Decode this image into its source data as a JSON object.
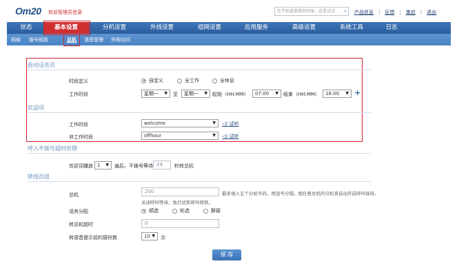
{
  "brand": {
    "logo": "Om20",
    "welcome": "欢迎管理员登录"
  },
  "search": {
    "placeholder": "在不知道菜单的时候，这里试试"
  },
  "top_links": [
    "产品信息",
    "反馈",
    "重启",
    "退出"
  ],
  "main_nav": [
    "状态",
    "基本设置",
    "分机设置",
    "外线设置",
    "组网设置",
    "应用服务",
    "高级设置",
    "系统工具",
    "日志"
  ],
  "main_nav_active": "基本设置",
  "sub_nav": [
    "网络",
    "拨号规则",
    "总机",
    "语音管理",
    "外网访问"
  ],
  "sub_nav_active": "总机",
  "auto_attendant": {
    "title": "自动话务员",
    "time_def_label": "时段定义",
    "radio_options": [
      "自定义",
      "全工作",
      "全休息"
    ],
    "radio_selected": "自定义",
    "work_time_label": "工作时段",
    "day_from": "星期一",
    "to_label": "至",
    "day_to": "星期一",
    "start_label": "起始（HH:MM）",
    "start_time": "07:00",
    "end_label": "结束（HH:MM）",
    "end_time": "16:00"
  },
  "greeting": {
    "title": "欢迎词",
    "work_label": "工作时段",
    "work_value": "welcome",
    "off_label": "非工作时段",
    "off_value": "offhour",
    "play_label": "试听"
  },
  "no_dial": {
    "title": "呼入不拨号超时处理",
    "text_a": "欢迎词播放",
    "loop_count": "1",
    "text_b": "遍后，不拨号等待",
    "wait_seconds": "24",
    "text_c": "秒转总机"
  },
  "operator_group": {
    "title": "转线员组",
    "ext_label": "总机",
    "ext_value": "200",
    "ext_hint": "最多填入五个分机号码，用逗号分隔。相任意总机的分机将自动开启呼叫保持，",
    "ext_hint2": "关闭呼叫等待、免打扰和呼叫转移。",
    "dist_label": "话务分配",
    "dist_options": [
      "顺选",
      "轮选",
      "群振"
    ],
    "dist_selected": "顺选",
    "timeout_label": "转总机超时",
    "timeout_value": "0",
    "ring_label": "转语音提示前的振铃数",
    "ring_value": "10",
    "ring_unit": "次"
  },
  "save_label": "保 存",
  "colors": {
    "nav_blue": "#2a5d9e",
    "active_red": "#cf2f2f",
    "highlight_box": "#d41f2e",
    "section_title": "#6f95bd"
  }
}
